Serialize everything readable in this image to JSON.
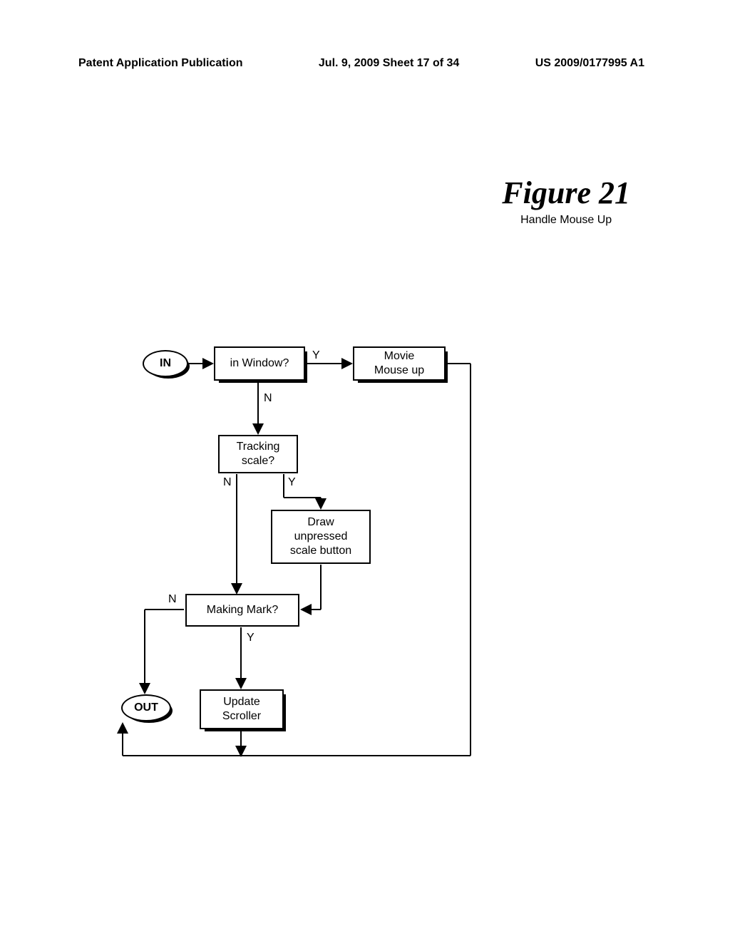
{
  "header": {
    "left": "Patent Application Publication",
    "center": "Jul. 9, 2009  Sheet 17 of 34",
    "right": "US 2009/0177995 A1"
  },
  "figure": {
    "title": "Figure 21",
    "subtitle": "Handle Mouse Up"
  },
  "nodes": {
    "in": "IN",
    "out": "OUT",
    "in_window": "in Window?",
    "movie_mouse_up": "Movie\nMouse up",
    "tracking_scale": "Tracking\nscale?",
    "draw_unpressed": "Draw\nunpressed\nscale button",
    "making_mark": "Making Mark?",
    "update_scroller": "Update\nScroller"
  },
  "labels": {
    "y1": "Y",
    "n1": "N",
    "n2": "N",
    "y2": "Y",
    "n3": "N",
    "y3": "Y"
  }
}
